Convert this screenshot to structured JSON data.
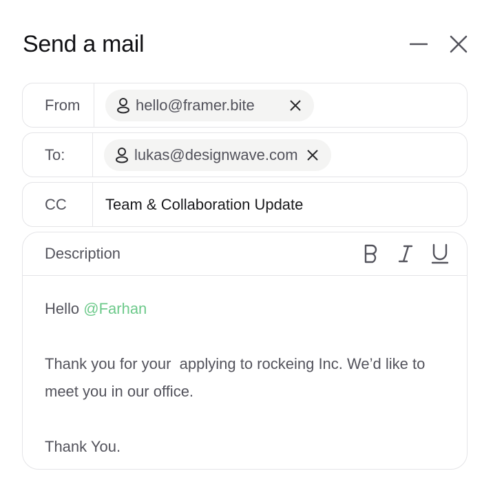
{
  "dialog": {
    "title": "Send a mail",
    "minimize_icon": "minimize-icon",
    "close_icon": "close-icon"
  },
  "fields": {
    "from": {
      "label": "From",
      "chip": {
        "icon": "person-icon",
        "email": "hello@framer.bite",
        "remove_icon": "close-icon"
      }
    },
    "to": {
      "label": "To:",
      "chip": {
        "icon": "person-icon",
        "email": "lukas@designwave.com",
        "remove_icon": "close-icon"
      }
    },
    "cc": {
      "label": "CC",
      "value": "Team & Collaboration Update"
    }
  },
  "description": {
    "label": "Description",
    "toolbar": {
      "bold_icon": "bold-icon",
      "italic_icon": "italic-icon",
      "underline_icon": "underline-icon"
    },
    "body": {
      "greeting": "Hello ",
      "mention": "@Farhan",
      "paragraph": "Thank you for your  applying to rockeing Inc. We’d like to meet you in our office.",
      "closing": "Thank You."
    }
  },
  "colors": {
    "mention": "#6cc98a",
    "border": "#e4e4e7",
    "chip_bg": "#f4f4f3",
    "title": "#111114",
    "text": "#52525b"
  }
}
